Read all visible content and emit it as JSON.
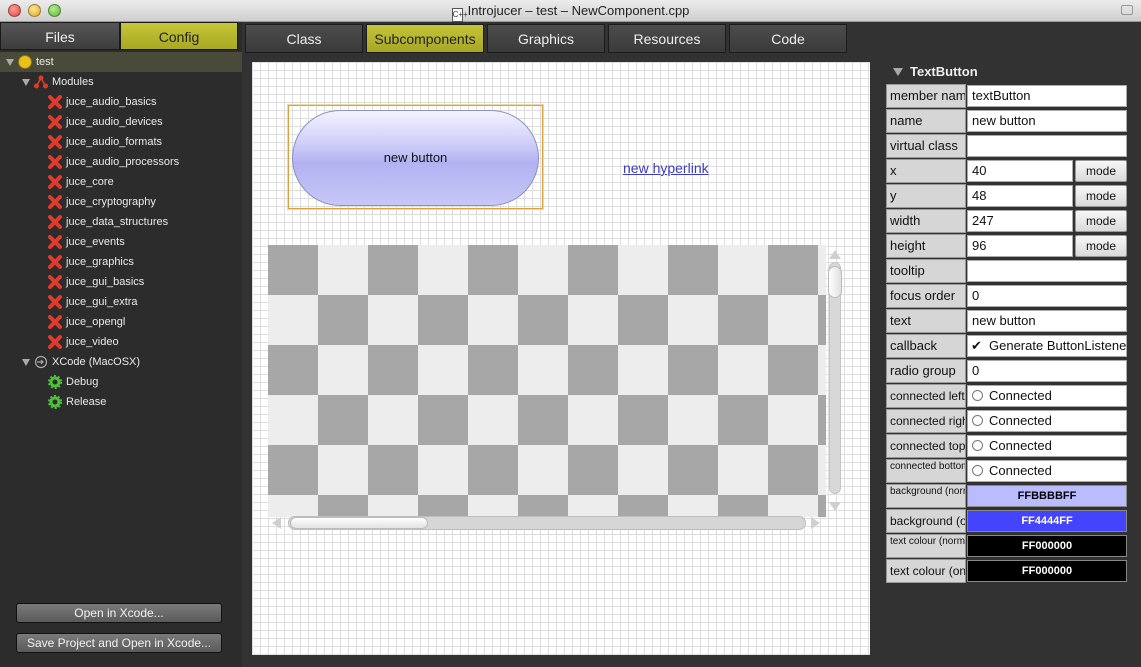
{
  "window": {
    "title": "Introjucer – test – NewComponent.cpp",
    "doc_icon": "C++"
  },
  "left_tabs": {
    "files": "Files",
    "config": "Config"
  },
  "tree": {
    "root": "test",
    "modules_label": "Modules",
    "modules": [
      "juce_audio_basics",
      "juce_audio_devices",
      "juce_audio_formats",
      "juce_audio_processors",
      "juce_core",
      "juce_cryptography",
      "juce_data_structures",
      "juce_events",
      "juce_graphics",
      "juce_gui_basics",
      "juce_gui_extra",
      "juce_opengl",
      "juce_video"
    ],
    "exporter": "XCode (MacOSX)",
    "configs": [
      "Debug",
      "Release"
    ]
  },
  "bottom_buttons": {
    "open": "Open in Xcode...",
    "save_open": "Save Project and Open in Xcode..."
  },
  "main_tabs": [
    "Class",
    "Subcomponents",
    "Graphics",
    "Resources",
    "Code"
  ],
  "active_tab": "Subcomponents",
  "canvas": {
    "button_text": "new button",
    "hyperlink_text": "new hyperlink"
  },
  "properties": {
    "title": "TextButton",
    "mode_label": "mode",
    "rows": [
      {
        "name": "member name",
        "value": "textButton"
      },
      {
        "name": "name",
        "value": "new button"
      },
      {
        "name": "virtual class",
        "value": ""
      },
      {
        "name": "x",
        "value": "40"
      },
      {
        "name": "y",
        "value": "48"
      },
      {
        "name": "width",
        "value": "247"
      },
      {
        "name": "height",
        "value": "96"
      },
      {
        "name": "tooltip",
        "value": ""
      },
      {
        "name": "focus order",
        "value": "0"
      },
      {
        "name": "text",
        "value": "new button"
      },
      {
        "name": "callback",
        "value": "Generate ButtonListener"
      },
      {
        "name": "radio group",
        "value": "0"
      },
      {
        "name": "connected left",
        "value": "Connected"
      },
      {
        "name": "connected right",
        "value": "Connected"
      },
      {
        "name": "connected top",
        "value": "Connected"
      },
      {
        "name": "connected bottom",
        "value": "Connected"
      },
      {
        "name": "background (normal)",
        "value": "FFBBBBFF"
      },
      {
        "name": "background (on)",
        "value": "FF4444FF"
      },
      {
        "name": "text colour (normal)",
        "value": "FF000000"
      },
      {
        "name": "text colour (on)",
        "value": "FF000000"
      }
    ]
  },
  "colors": {
    "accent": "#b5b52e",
    "bg_normal": "#BBBBFF",
    "bg_on": "#4444FF",
    "text_normal": "#000000",
    "text_on": "#000000"
  }
}
